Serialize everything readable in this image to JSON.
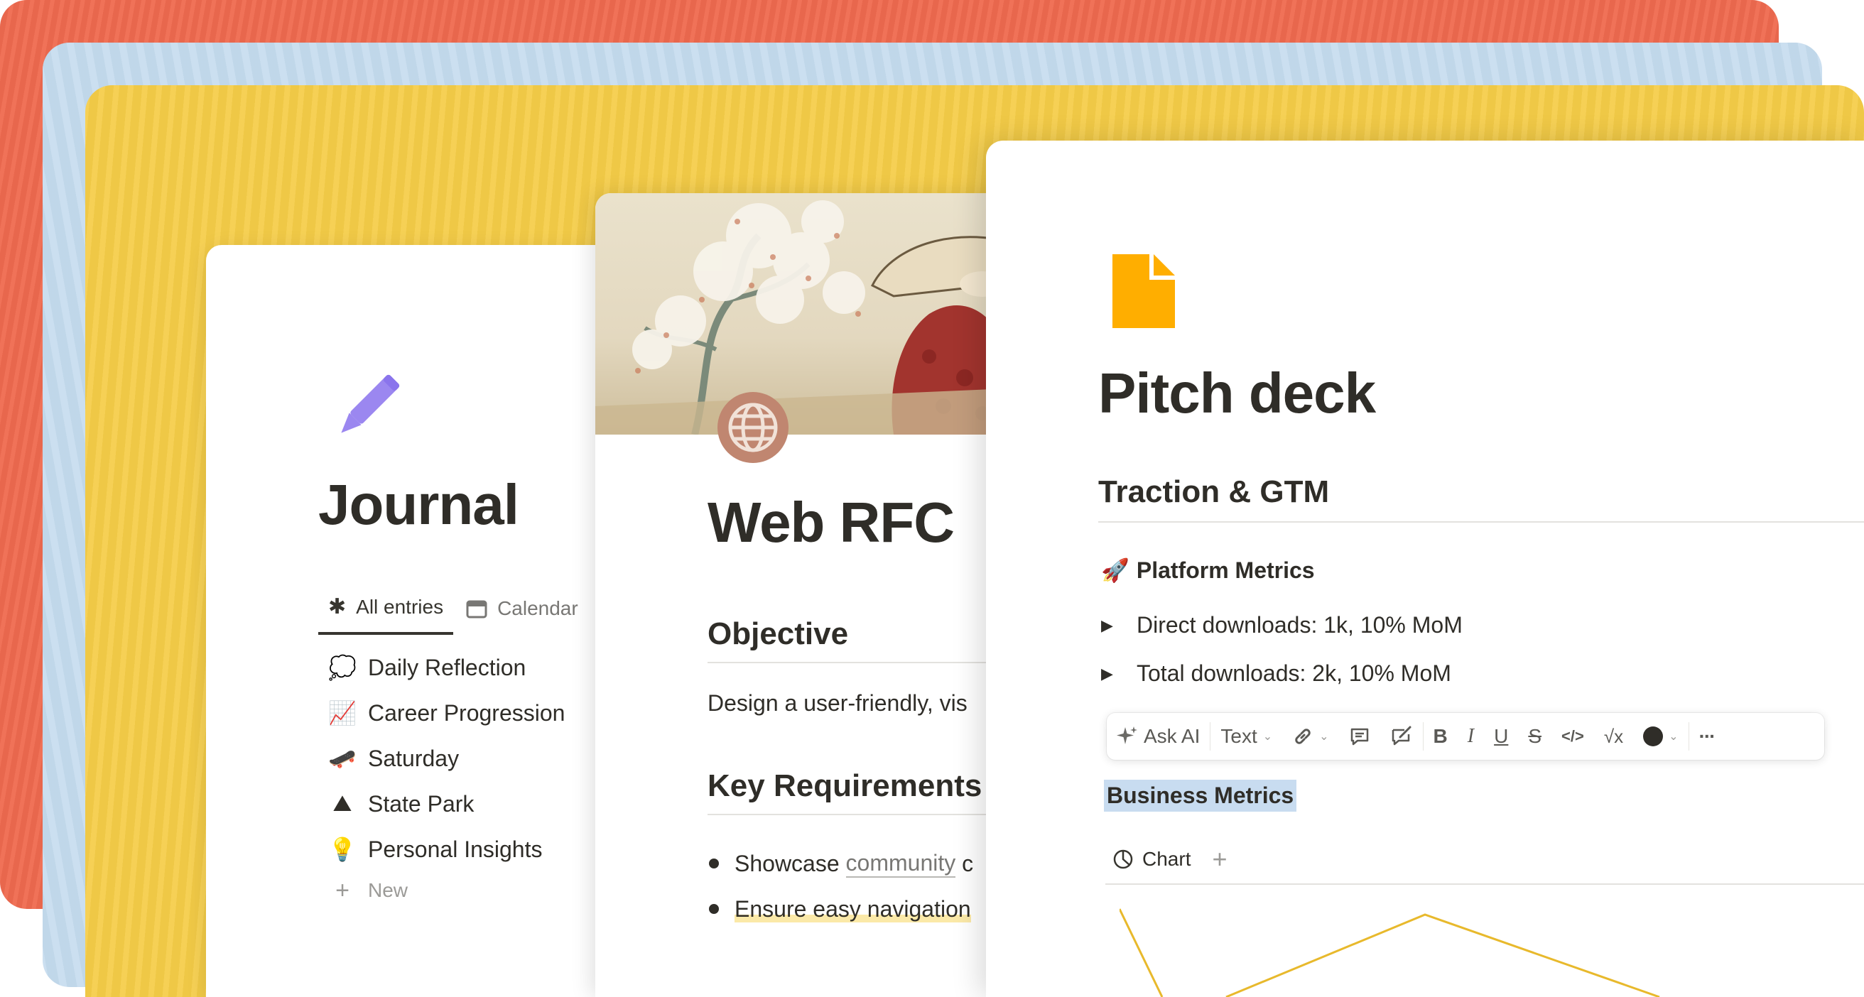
{
  "journal": {
    "title": "Journal",
    "icon": "pencil-icon",
    "tabs": [
      {
        "label": "All entries",
        "icon": "asterisk-icon",
        "active": true
      },
      {
        "label": "Calendar",
        "icon": "calendar-icon",
        "active": false
      }
    ],
    "entries": [
      {
        "emoji": "💭",
        "label": "Daily Reflection"
      },
      {
        "emoji": "📈",
        "label": "Career Progression"
      },
      {
        "emoji": "🛹",
        "label": "Saturday"
      },
      {
        "emoji": "⛰",
        "label": "State Park"
      },
      {
        "emoji": "💡",
        "label": "Personal Insights"
      }
    ],
    "new_label": "New",
    "new_icon": "+"
  },
  "rfc": {
    "title": "Web RFC",
    "icon": "globe-icon",
    "objective_heading": "Objective",
    "objective_text": "Design a user-friendly, vis",
    "requirements_heading": "Key Requirements",
    "bullet_1_prefix": "Showcase ",
    "bullet_1_link": "community",
    "bullet_1_suffix": " c",
    "bullet_2": "Ensure easy navigation"
  },
  "pitch": {
    "title": "Pitch deck",
    "icon": "document-icon",
    "section_heading": "Traction & GTM",
    "metrics_emoji": "🚀",
    "metrics_heading": "Platform Metrics",
    "toggle_marker": "▶",
    "toggles": [
      "Direct downloads: 1k, 10% MoM",
      "Total downloads: 2k, 10% MoM"
    ],
    "toolbar": {
      "ask_ai": "Ask AI",
      "text": "Text",
      "bold": "B",
      "italic": "I",
      "underline": "U",
      "strike": "S",
      "code": "</>",
      "equation": "√x",
      "more": "···"
    },
    "selected_text": "Business Metrics",
    "chart_tab_label": "Chart",
    "chart_add": "+"
  },
  "colors": {
    "coral": "#ef6a4f",
    "blue": "#c4dbee",
    "yellow": "#f5cd48",
    "pencil": "#9b87f0",
    "globe": "#c08670",
    "doc": "#ffae00",
    "selection": "#c8dcf0",
    "chart_line": "#e8b92c"
  }
}
